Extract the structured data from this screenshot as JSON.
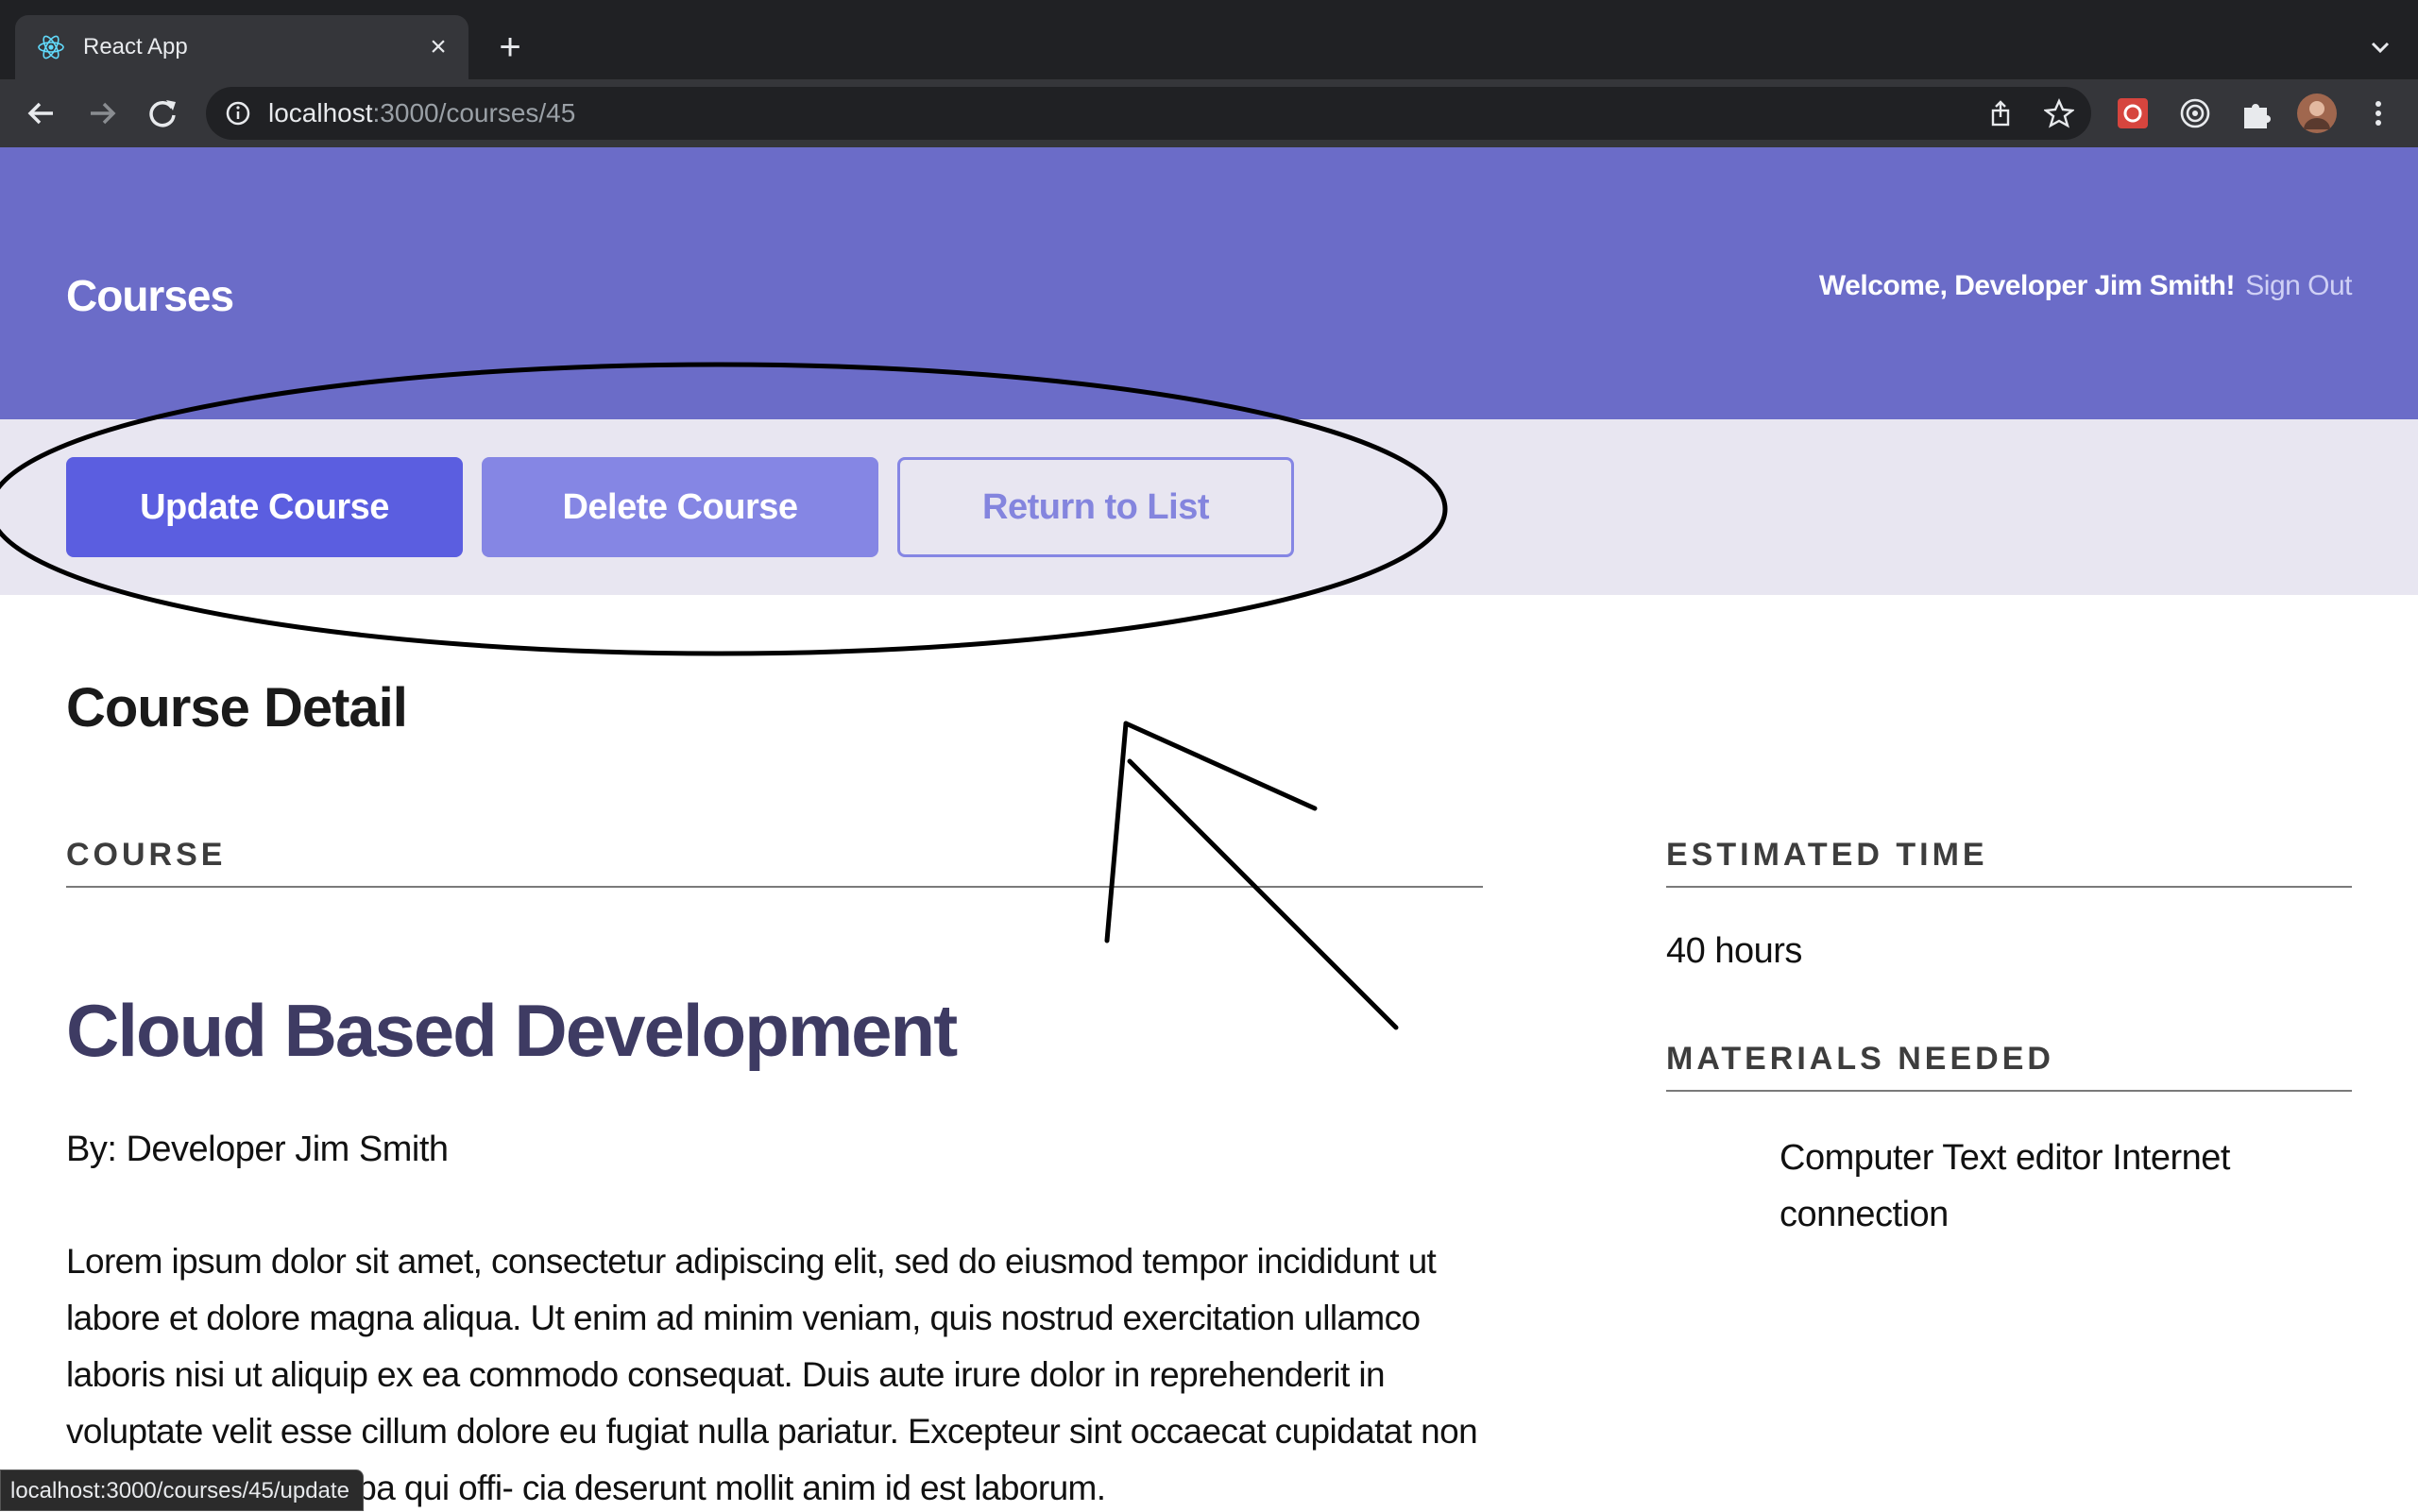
{
  "browser": {
    "tab_title": "React App",
    "url_host": "localhost",
    "url_path": ":3000/courses/45",
    "status_url": "localhost:3000/courses/45/update"
  },
  "header": {
    "brand": "Courses",
    "welcome": "Welcome, Developer Jim Smith!",
    "sign_out": "Sign Out"
  },
  "actions": {
    "update": "Update Course",
    "delete": "Delete Course",
    "return": "Return to List"
  },
  "detail": {
    "section_title": "Course Detail",
    "course_heading": "COURSE",
    "course_title": "Cloud Based Development",
    "byline": "By: Developer Jim Smith",
    "description": "Lorem ipsum dolor sit amet, consectetur adipiscing elit, sed do eiusmod tempor incididunt ut labore et dolore magna aliqua. Ut enim ad minim veniam, quis nostrud exercitation ullamco laboris nisi ut aliquip ex ea commodo consequat. Duis aute irure dolor in reprehenderit in voluptate velit esse cillum dolore eu fugiat nulla pariatur. Excepteur sint occaecat cupidatat non proident, sunt in culpa qui offi- cia deserunt mollit anim id est laborum.",
    "time_heading": "ESTIMATED TIME",
    "time_value": "40 hours",
    "materials_heading": "MATERIALS NEEDED",
    "materials": "Computer Text editor Internet connection"
  },
  "colors": {
    "header_bg": "#6b6cc8",
    "actions_bg": "#e8e6f1",
    "update_btn": "#5b5ee0",
    "delete_btn": "#8586e4",
    "course_title": "#3e3b63"
  }
}
